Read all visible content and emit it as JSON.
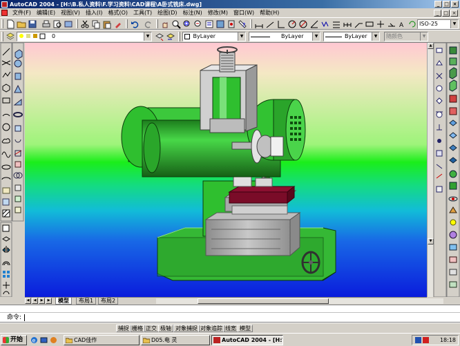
{
  "window": {
    "title": "AutoCAD 2004 - [H:\\B.私人资料\\F.学习资料\\CAD课程\\A卧式铣床.dwg]",
    "controls": [
      "_",
      "□",
      "×"
    ]
  },
  "menu": {
    "items": [
      "文件(F)",
      "编辑(E)",
      "视图(V)",
      "插入(I)",
      "格式(O)",
      "工具(T)",
      "绘图(D)",
      "标注(N)",
      "修改(M)",
      "窗口(W)",
      "帮助(H)"
    ],
    "doc_controls": [
      "_",
      "□",
      "×"
    ]
  },
  "toolbar": {
    "dim_style": "ISO-25",
    "layer": "0",
    "color": "ByLayer",
    "linetype": "ByLayer",
    "lineweight": "ByLayer",
    "plot_style": "随颜色"
  },
  "layout_tabs": {
    "items": [
      "模型",
      "布局1",
      "布局2"
    ],
    "active": "模型"
  },
  "command": {
    "prompt": "命令:"
  },
  "status": {
    "toggles": [
      "捕捉",
      "栅格",
      "正交",
      "极轴",
      "对象捕捉",
      "对象追踪",
      "线宽",
      "模型"
    ]
  },
  "taskbar": {
    "start": "开始",
    "tasks": [
      "CAD佳作",
      "D05.电 灵",
      "AutoCAD 2004 - [H:\\..."
    ],
    "active_task": "AutoCAD 2004 - [H:\\...",
    "clock": "18:18"
  },
  "colors": {
    "titlebar": "#0a246a",
    "machine_green": "#2fbf2f",
    "machine_gray": "#a8a8a8",
    "table_red": "#8c1030",
    "viewport_top": "#ffc8d2",
    "viewport_bottom": "#0a1cdc"
  },
  "icons": {
    "app": "autocad-app-icon",
    "document": "drawing-document-icon"
  }
}
